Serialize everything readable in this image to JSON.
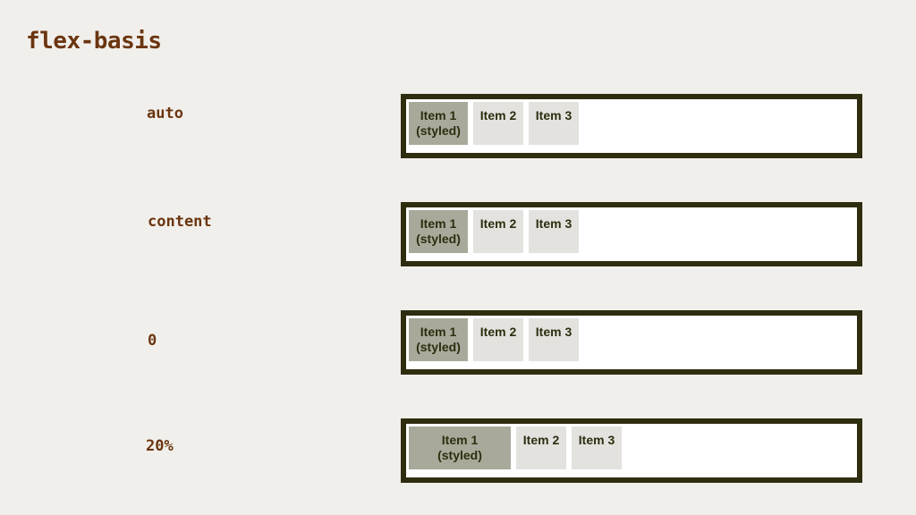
{
  "page": {
    "title": "flex-basis"
  },
  "colors": {
    "background": "#f1efeb",
    "label_text": "#6b3510",
    "container_border": "#2e2d0f",
    "container_fill": "#ffffff",
    "item_fill": "#e3e2df",
    "styled_item_fill": "#a8a99a",
    "item_text": "#2e2d0f"
  },
  "rows": [
    {
      "label": "auto",
      "items": [
        {
          "line1": "Item 1",
          "line2": "(styled)"
        },
        {
          "line1": "Item 2"
        },
        {
          "line1": "Item 3"
        }
      ]
    },
    {
      "label": "content",
      "items": [
        {
          "line1": "Item 1",
          "line2": "(styled)"
        },
        {
          "line1": "Item 2"
        },
        {
          "line1": "Item 3"
        }
      ]
    },
    {
      "label": "0",
      "items": [
        {
          "line1": "Item 1",
          "line2": "(styled)"
        },
        {
          "line1": "Item 2"
        },
        {
          "line1": "Item 3"
        }
      ]
    },
    {
      "label": "20%",
      "items": [
        {
          "line1": "Item 1",
          "line2": "(styled)"
        },
        {
          "line1": "Item 2"
        },
        {
          "line1": "Item 3"
        }
      ]
    }
  ]
}
